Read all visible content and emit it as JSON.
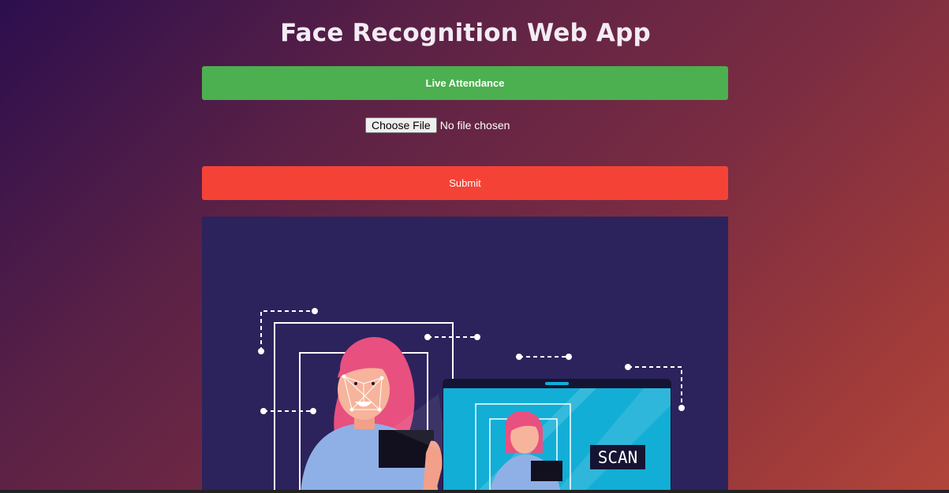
{
  "header": {
    "title": "Face Recognition Web App"
  },
  "actions": {
    "live_label": "Live Attendance",
    "submit_label": "Submit"
  },
  "file_input": {
    "button_label": "Choose File",
    "status": "No file chosen"
  },
  "hero": {
    "scan_label": "SCAN"
  },
  "colors": {
    "live_button": "#4caf50",
    "submit_button": "#f44336",
    "hero_background": "#2c235c",
    "laptop_screen": "#12aed6",
    "hair": "#e8507f"
  }
}
